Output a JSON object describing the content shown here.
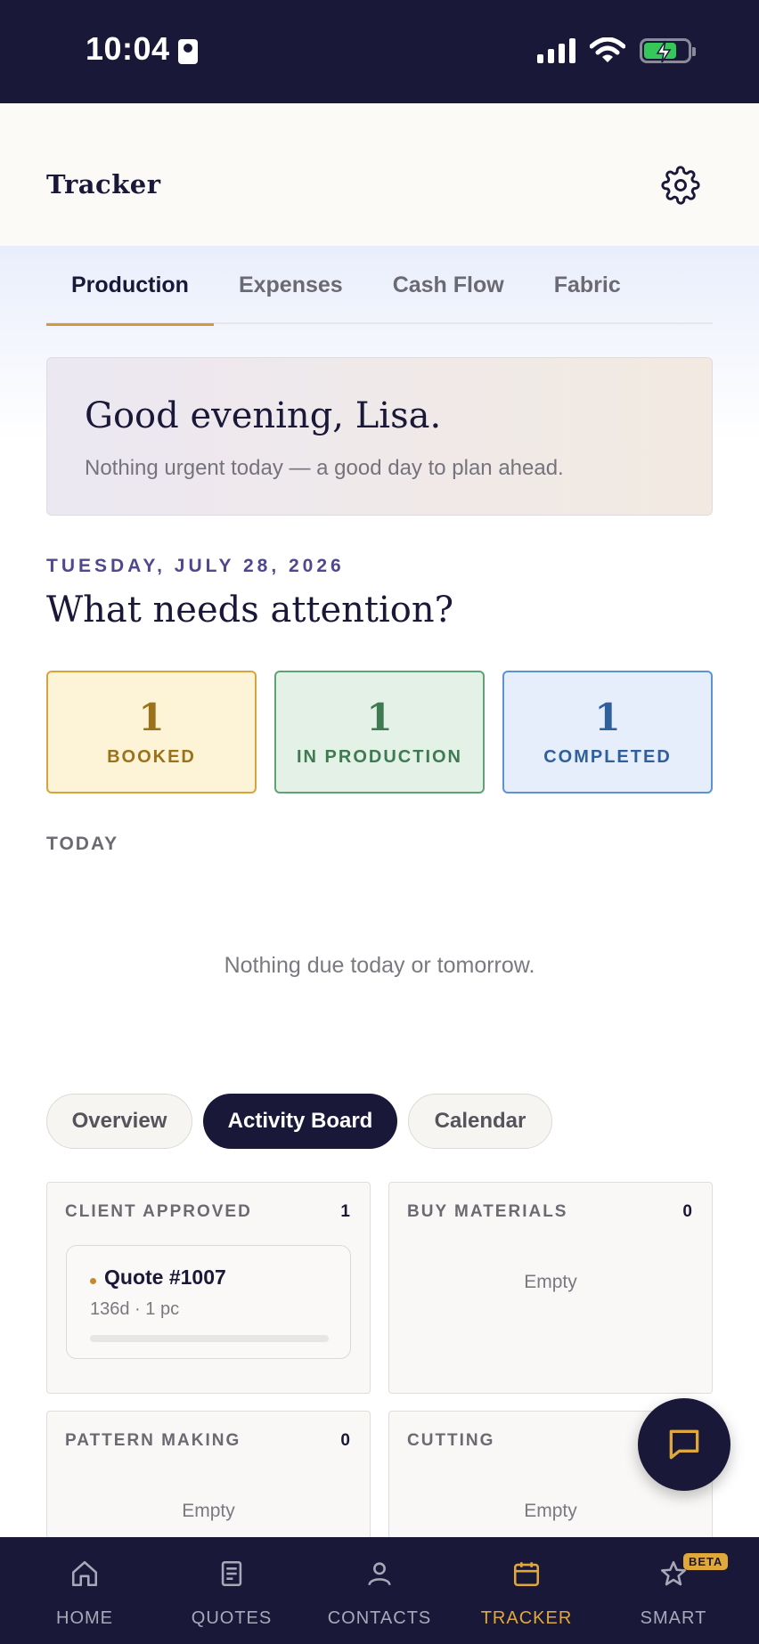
{
  "status_bar": {
    "time": "10:04"
  },
  "header": {
    "title": "Tracker"
  },
  "tabs": [
    {
      "label": "Production",
      "active": true
    },
    {
      "label": "Expenses",
      "active": false
    },
    {
      "label": "Cash Flow",
      "active": false
    },
    {
      "label": "Fabric",
      "active": false
    }
  ],
  "greeting": {
    "title": "Good evening, Lisa.",
    "subtitle": "Nothing urgent today — a good day to plan ahead."
  },
  "date_label": "TUESDAY, JULY 28, 2026",
  "attention_title": "What needs attention?",
  "stats": [
    {
      "value": "1",
      "label": "BOOKED"
    },
    {
      "value": "1",
      "label": "IN PRODUCTION"
    },
    {
      "value": "1",
      "label": "COMPLETED"
    }
  ],
  "today": {
    "label": "TODAY",
    "empty_text": "Nothing due today or tomorrow."
  },
  "views": [
    {
      "label": "Overview",
      "active": false
    },
    {
      "label": "Activity Board",
      "active": true
    },
    {
      "label": "Calendar",
      "active": false
    }
  ],
  "board": [
    {
      "title": "CLIENT APPROVED",
      "count": "1",
      "empty": ""
    },
    {
      "title": "BUY MATERIALS",
      "count": "0",
      "empty": "Empty"
    },
    {
      "title": "PATTERN MAKING",
      "count": "0",
      "empty": "Empty"
    },
    {
      "title": "CUTTING",
      "count": "",
      "empty": "Empty"
    }
  ],
  "quote_card": {
    "title": "Quote #1007",
    "meta": "136d · 1 pc",
    "progress": 0
  },
  "nav": [
    {
      "label": "HOME",
      "icon": "home-icon"
    },
    {
      "label": "QUOTES",
      "icon": "document-icon"
    },
    {
      "label": "CONTACTS",
      "icon": "person-icon"
    },
    {
      "label": "TRACKER",
      "icon": "calendar-icon",
      "active": true
    },
    {
      "label": "SMART",
      "icon": "star-icon",
      "badge": "BETA"
    }
  ],
  "colors": {
    "navy": "#1a1838",
    "accent": "#d29a3c",
    "booked": "#9b7219",
    "in_production": "#3e7a52",
    "completed": "#2f5f9c"
  }
}
